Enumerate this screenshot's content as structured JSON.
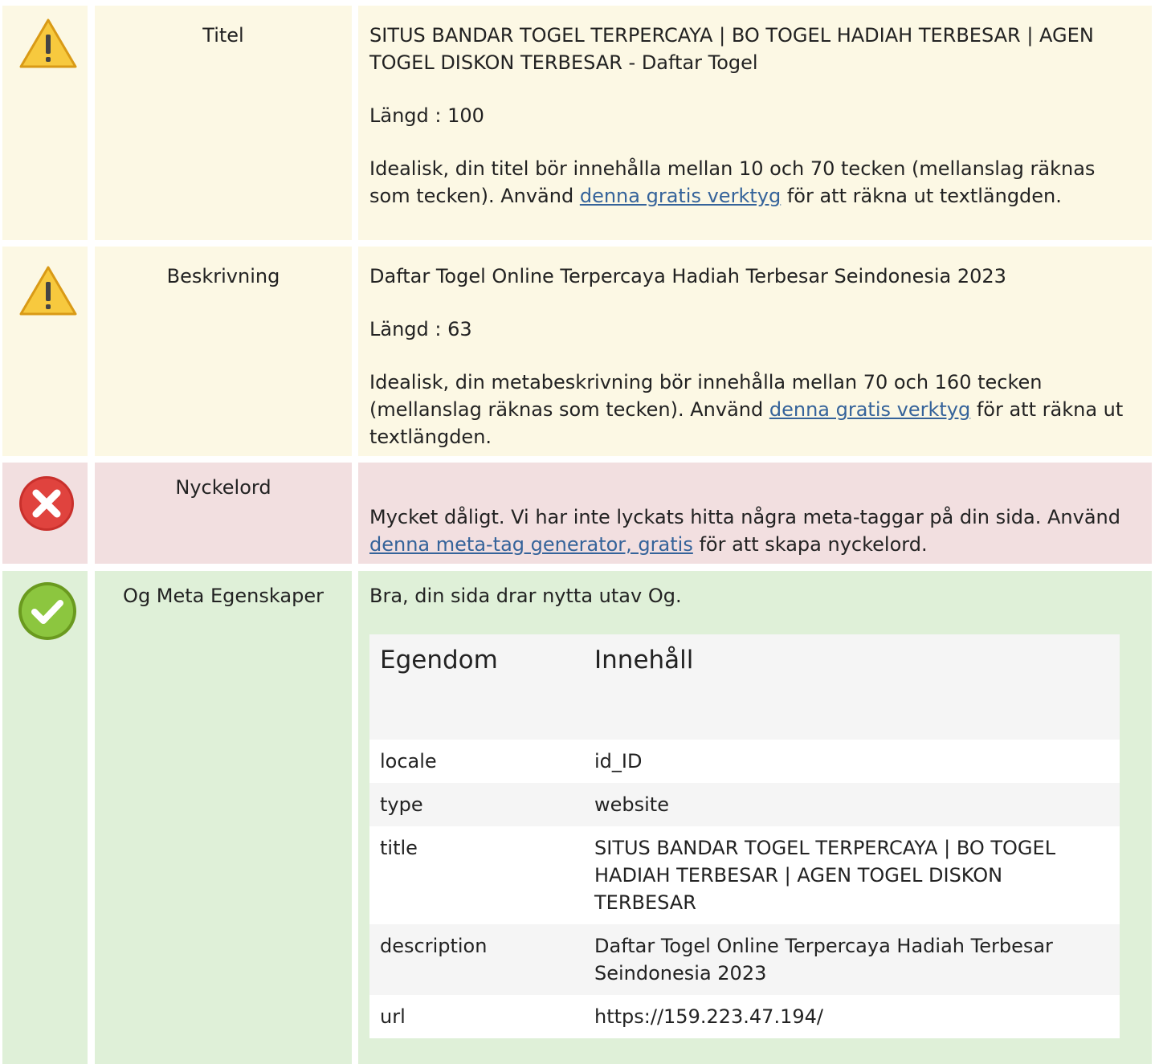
{
  "rows": {
    "title": {
      "label": "Titel",
      "status": "warning",
      "value": "SITUS BANDAR TOGEL TERPERCAYA | BO TOGEL HADIAH TERBESAR | AGEN TOGEL DISKON TERBESAR - Daftar Togel",
      "length": "Längd : 100",
      "advice_pre": "Idealisk, din titel bör innehålla mellan 10 och 70 tecken (mellanslag räknas som tecken). Använd ",
      "advice_link": "denna gratis verktyg",
      "advice_post": " för att räkna ut textlängden."
    },
    "description": {
      "label": "Beskrivning",
      "status": "warning",
      "value": "Daftar Togel Online Terpercaya Hadiah Terbesar Seindonesia 2023",
      "length": "Längd : 63",
      "advice_pre": "Idealisk, din metabeskrivning bör innehålla mellan 70 och 160 tecken (mellanslag räknas som tecken). Använd ",
      "advice_link": "denna gratis verktyg",
      "advice_post": " för att räkna ut textlängden."
    },
    "keywords": {
      "label": "Nyckelord",
      "status": "error",
      "advice_pre": "Mycket dåligt. Vi har inte lyckats hitta några meta-taggar på din sida. Använd ",
      "advice_link": "denna meta-tag generator, gratis",
      "advice_post": " för att skapa nyckelord."
    },
    "og": {
      "label": "Og Meta Egenskaper",
      "status": "ok",
      "summary": "Bra, din sida drar nytta utav Og.",
      "table_headers": [
        "Egendom",
        "Innehåll"
      ],
      "table_rows": [
        {
          "property": "locale",
          "content": "id_ID"
        },
        {
          "property": "type",
          "content": "website"
        },
        {
          "property": "title",
          "content": "SITUS BANDAR TOGEL TERPERCAYA | BO TOGEL HADIAH TERBESAR | AGEN TOGEL DISKON TERBESAR"
        },
        {
          "property": "description",
          "content": "Daftar Togel Online Terpercaya Hadiah Terbesar Seindonesia 2023"
        },
        {
          "property": "url",
          "content": "https://159.223.47.194/"
        }
      ]
    }
  },
  "colors": {
    "warning_bg": "#fcf8e4",
    "error_bg": "#f2dfe0",
    "ok_bg": "#dff0d8",
    "link": "#35639a"
  }
}
